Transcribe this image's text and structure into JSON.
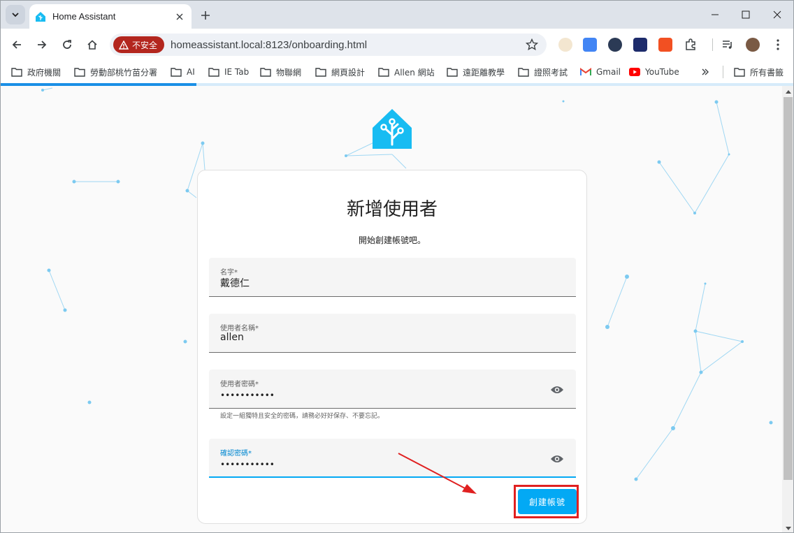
{
  "browser": {
    "tab": {
      "title": "Home Assistant"
    },
    "address": {
      "security_label": "不安全",
      "url": "homeassistant.local:8123/onboarding.html"
    },
    "bookmarks": [
      {
        "label": "政府機關",
        "icon": "folder-icon"
      },
      {
        "label": "勞動部桃竹苗分署",
        "icon": "folder-icon"
      },
      {
        "label": "AI",
        "icon": "folder-icon"
      },
      {
        "label": "IE Tab",
        "icon": "folder-icon"
      },
      {
        "label": "物聯網",
        "icon": "folder-icon"
      },
      {
        "label": "網頁設計",
        "icon": "folder-icon"
      },
      {
        "label": "Allen 網站",
        "icon": "folder-icon"
      },
      {
        "label": "遠距離教學",
        "icon": "folder-icon"
      },
      {
        "label": "證照考試",
        "icon": "folder-icon"
      },
      {
        "label": "Gmail",
        "icon": "gmail-icon"
      },
      {
        "label": "YouTube",
        "icon": "youtube-icon"
      }
    ],
    "all_bookmarks": "所有書籤",
    "colors": {
      "tabstrip": "#dee3ea",
      "warning": "#b3261e",
      "progress": "#1a8fe6"
    }
  },
  "onboarding": {
    "title": "新增使用者",
    "subtitle": "開始創建帳號吧。",
    "fields": {
      "name": {
        "label": "名字*",
        "value": "戴德仁"
      },
      "username": {
        "label": "使用者名稱*",
        "value": "allen"
      },
      "password": {
        "label": "使用者密碼*",
        "value": "•••••••••••"
      },
      "password_helper": "設定一組獨特且安全的密碼，請務必好好保存、不要忘記。",
      "confirm": {
        "label": "確認密碼*",
        "value": "•••••••••••"
      }
    },
    "create_button": "創建帳號",
    "colors": {
      "primary": "#03a9f4",
      "highlight": "#e02020"
    }
  }
}
